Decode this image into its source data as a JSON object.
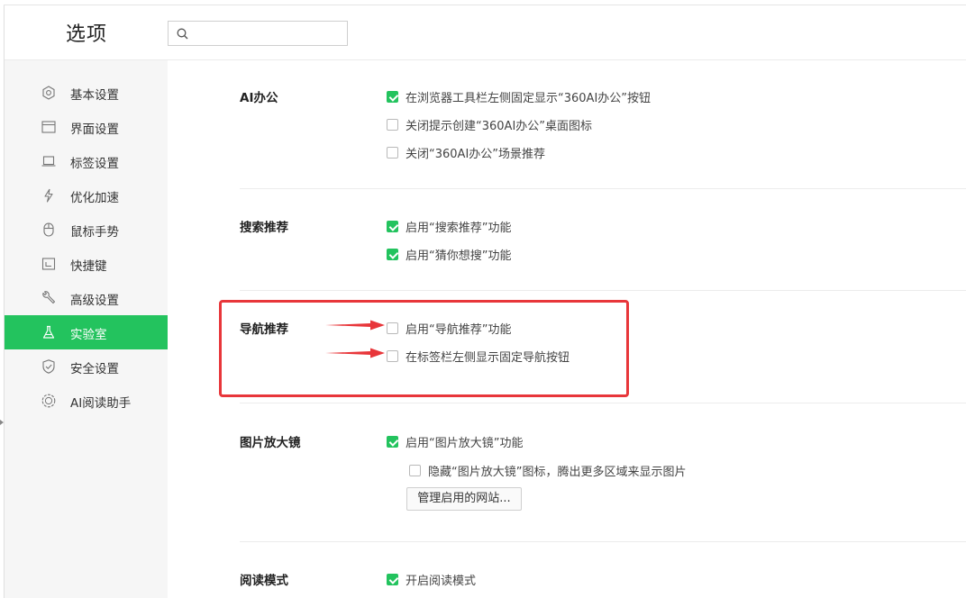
{
  "header": {
    "title": "选项",
    "search": {
      "value": "",
      "placeholder": ""
    }
  },
  "sidebar": {
    "items": [
      {
        "label": "基本设置",
        "icon": "gear-icon"
      },
      {
        "label": "界面设置",
        "icon": "window-icon"
      },
      {
        "label": "标签设置",
        "icon": "tab-icon"
      },
      {
        "label": "优化加速",
        "icon": "lightning-icon"
      },
      {
        "label": "鼠标手势",
        "icon": "mouse-icon"
      },
      {
        "label": "快捷键",
        "icon": "keyboard-icon"
      },
      {
        "label": "高级设置",
        "icon": "wrench-icon"
      },
      {
        "label": "实验室",
        "icon": "flask-icon",
        "active": true
      },
      {
        "label": "安全设置",
        "icon": "shield-icon"
      },
      {
        "label": "AI阅读助手",
        "icon": "ai-icon"
      }
    ]
  },
  "sections": {
    "ai_office": {
      "title": "AI办公",
      "options": [
        {
          "label": "在浏览器工具栏左侧固定显示“360AI办公”按钮",
          "checked": true
        },
        {
          "label": "关闭提示创建“360AI办公”桌面图标",
          "checked": false
        },
        {
          "label": "关闭“360AI办公”场景推荐",
          "checked": false
        }
      ]
    },
    "search_recommend": {
      "title": "搜索推荐",
      "options": [
        {
          "label": "启用“搜索推荐”功能",
          "checked": true
        },
        {
          "label": "启用“猜你想搜”功能",
          "checked": true
        }
      ]
    },
    "nav_recommend": {
      "title": "导航推荐",
      "options": [
        {
          "label": "启用“导航推荐”功能",
          "checked": false
        },
        {
          "label": "在标签栏左侧显示固定导航按钮",
          "checked": false
        }
      ]
    },
    "image_magnifier": {
      "title": "图片放大镜",
      "options": [
        {
          "label": "启用“图片放大镜”功能",
          "checked": true
        },
        {
          "label": "隐藏“图片放大镜”图标，腾出更多区域来显示图片",
          "checked": false
        }
      ],
      "manage_button": "管理启用的网站..."
    },
    "reading_mode": {
      "title": "阅读模式",
      "options": [
        {
          "label": "开启阅读模式",
          "checked": true
        }
      ]
    }
  },
  "colors": {
    "accent": "#23c35e",
    "highlight": "#e8363a"
  }
}
